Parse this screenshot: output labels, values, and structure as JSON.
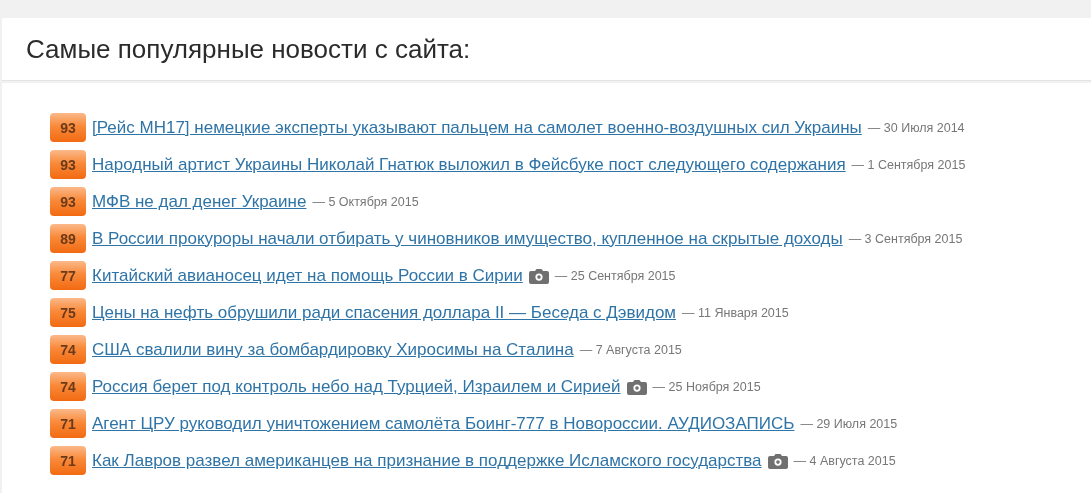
{
  "header": {
    "title": "Самые популярные новости с сайта:"
  },
  "news": [
    {
      "score": "93",
      "title": "[Рейс MH17] немецкие эксперты указывают пальцем на самолет военно-воздушных сил Украины",
      "photo": false,
      "date": "— 30 Июля 2014"
    },
    {
      "score": "93",
      "title": "Народный артист Украины Николай Гнатюк выложил в Фейсбуке пост следующего содержания",
      "photo": false,
      "date": "— 1 Сентября 2015"
    },
    {
      "score": "93",
      "title": "МФВ не дал денег Украине",
      "photo": false,
      "date": "— 5 Октября 2015"
    },
    {
      "score": "89",
      "title": "В России прокуроры начали отбирать у чиновников имущество, купленное на скрытые доходы",
      "photo": false,
      "date": "— 3 Сентября 2015"
    },
    {
      "score": "77",
      "title": "Китайский авианосец идет на помощь России в Сирии",
      "photo": true,
      "date": "— 25 Сентября 2015"
    },
    {
      "score": "75",
      "title": "Цены на нефть обрушили ради спасения доллара II — Беседа с Дэвидом",
      "photo": false,
      "date": "— 11 Января 2015"
    },
    {
      "score": "74",
      "title": "США свалили вину за бомбардировку Хиросимы на Сталина",
      "photo": false,
      "date": "— 7 Августа 2015"
    },
    {
      "score": "74",
      "title": "Россия берет под контроль небо над Турцией, Израилем и Сирией",
      "photo": true,
      "date": "— 25 Ноября 2015"
    },
    {
      "score": "71",
      "title": "Агент ЦРУ руководил уничтожением самолёта Боинг-777 в Новороссии. АУДИОЗАПИСЬ",
      "photo": false,
      "date": "— 29 Июля 2015"
    },
    {
      "score": "71",
      "title": "Как Лавров развел американцев на признание в поддержке Исламского государства",
      "photo": true,
      "date": "— 4 Августа 2015"
    }
  ]
}
